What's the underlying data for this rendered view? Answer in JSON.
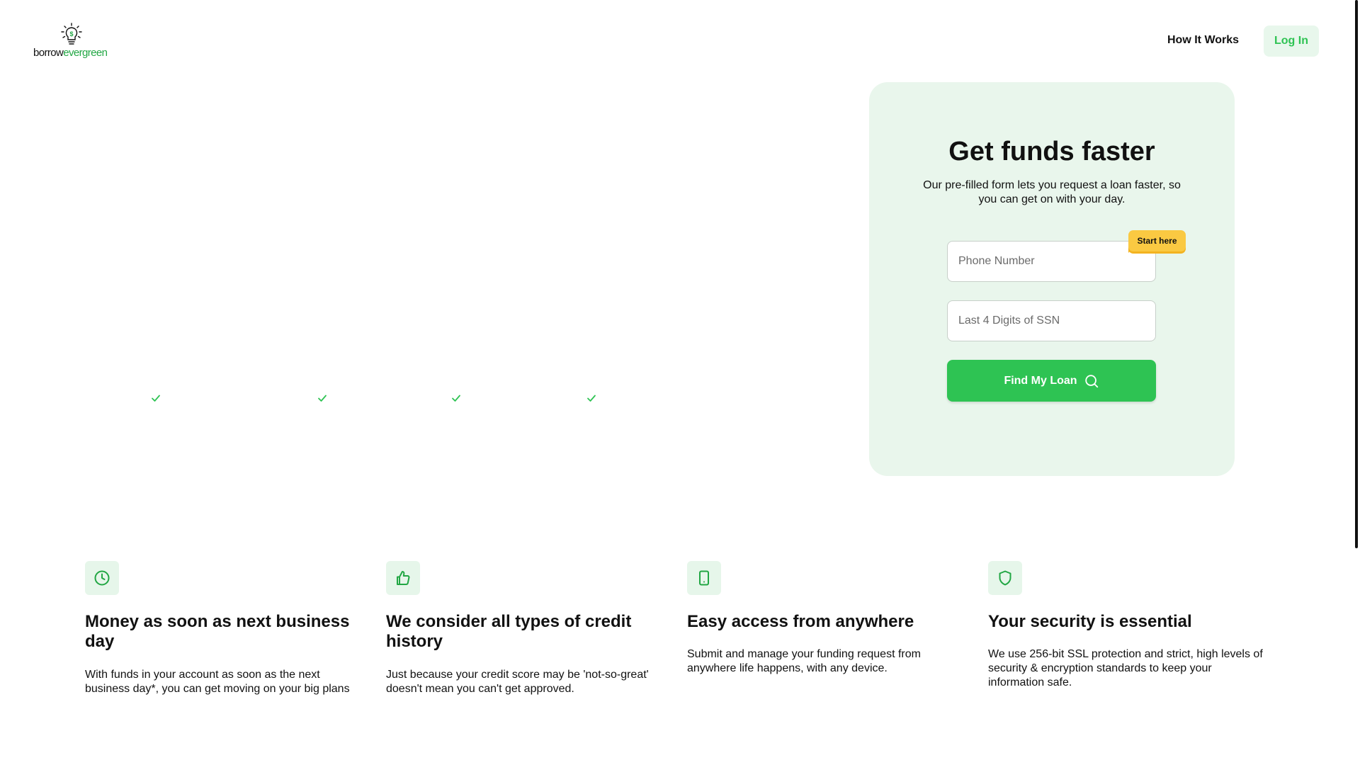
{
  "logo": {
    "word_dark": "borrow",
    "word_green": "evergreen"
  },
  "nav": {
    "how_it_works": "How It Works",
    "login": "Log In"
  },
  "form": {
    "title": "Get funds faster",
    "subtitle": "Our pre-filled form lets you request a loan faster, so you can get on with your day.",
    "phone_placeholder": "Phone Number",
    "ssn_placeholder": "Last 4 Digits of SSN",
    "start_tag": "Start here",
    "button": "Find My Loan"
  },
  "features": [
    {
      "icon": "clock-icon",
      "title": "Money as soon as next business day",
      "text": "With funds in your account as soon as the next business day*, you can get moving on your big plans"
    },
    {
      "icon": "thumbs-up-icon",
      "title": "We consider all types of credit history",
      "text": "Just because your credit score may be 'not-so-great' doesn't mean you can't get approved."
    },
    {
      "icon": "smartphone-icon",
      "title": "Easy access from anywhere",
      "text": "Submit and manage your funding request from anywhere life happens, with any device."
    },
    {
      "icon": "shield-icon",
      "title": "Your security is essential",
      "text": "We use 256-bit SSL protection and strict, high levels of security & encryption standards to keep your information safe."
    }
  ],
  "colors": {
    "brand_green": "#2ec353",
    "card_bg": "#e9f6ec",
    "tag_yellow": "#fac942"
  }
}
